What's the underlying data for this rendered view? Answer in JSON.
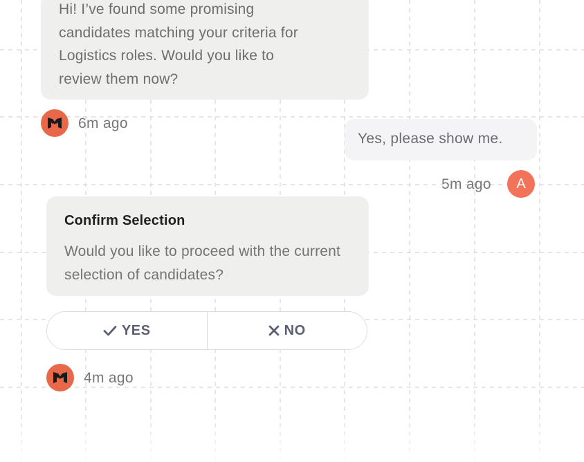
{
  "chat": {
    "messages": [
      {
        "sender": "bot",
        "lines": [
          "Hi! I’ve found some promising",
          "candidates matching your criteria for",
          "Logistics roles. Would you like to",
          "review them now?"
        ],
        "time": "6m ago",
        "avatar_icon": "m-logo-icon"
      },
      {
        "sender": "user",
        "text": "Yes, please show me.",
        "time": "5m ago",
        "avatar_initial": "A"
      },
      {
        "sender": "bot",
        "card": {
          "title": "Confirm Selection",
          "text": "Would you like to proceed with the current selection of candidates?"
        },
        "actions": {
          "yes_label": "YES",
          "yes_icon": "check-icon",
          "no_label": "NO",
          "no_icon": "x-icon"
        },
        "time": "4m ago",
        "avatar_icon": "m-logo-icon"
      }
    ]
  },
  "colors": {
    "bot_avatar": "#e8694a",
    "user_avatar": "#f2735a",
    "bubble_bg": "#efefed",
    "user_bubble_bg": "#f4f4f6",
    "action_text": "#5a5f73"
  }
}
